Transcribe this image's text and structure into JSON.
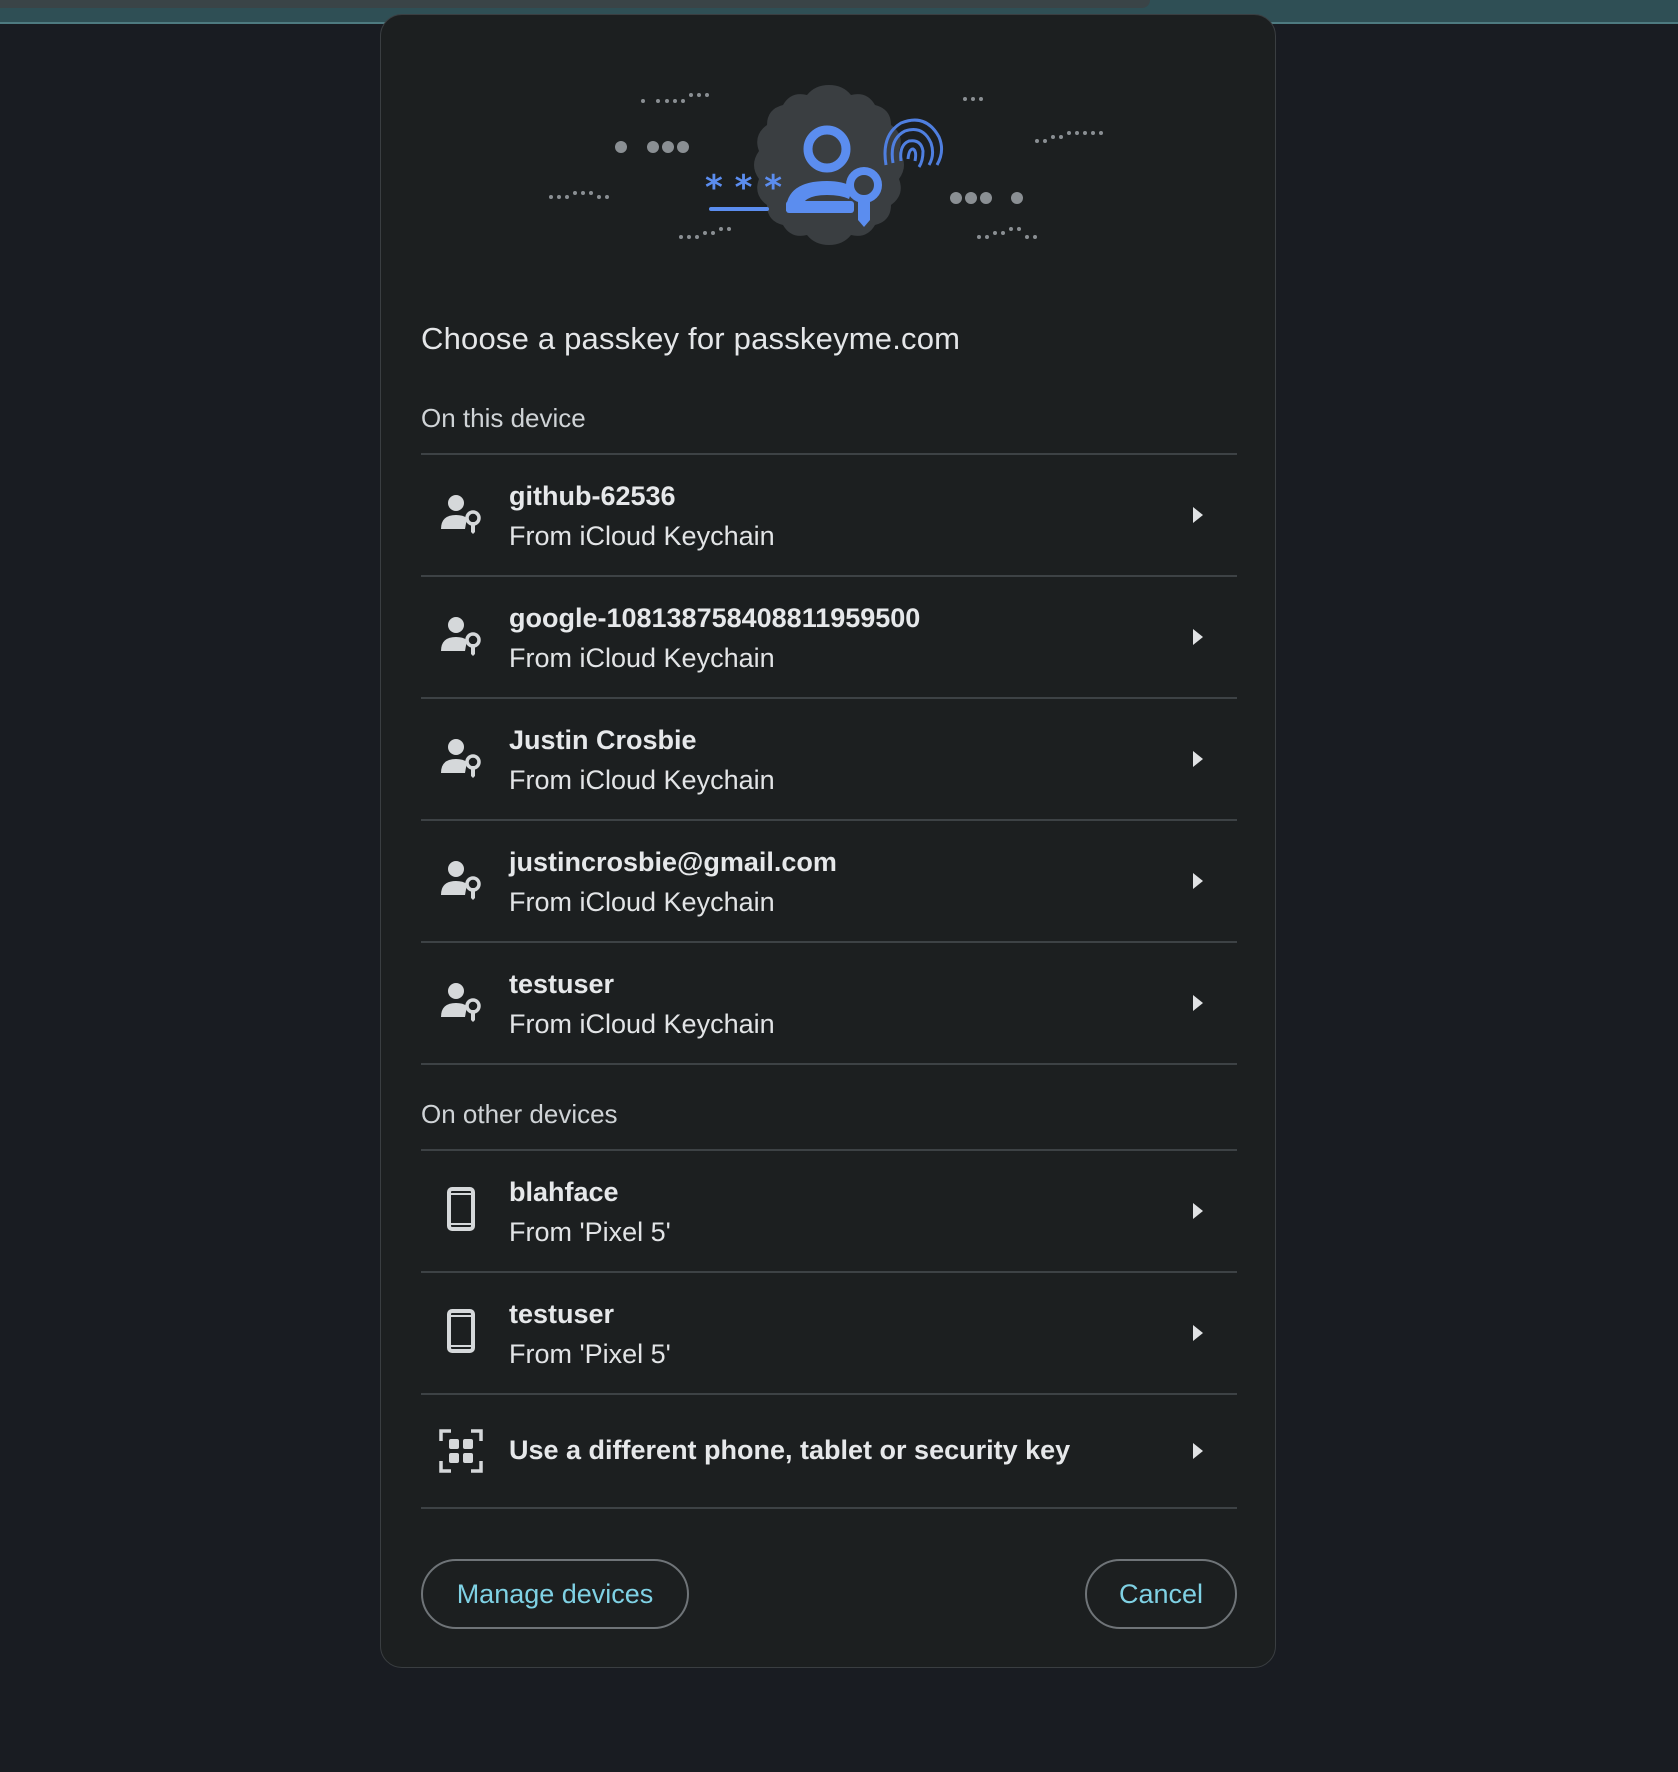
{
  "dialog": {
    "title": "Choose a passkey for passkeyme.com",
    "accent_color": "#5b8def"
  },
  "sections": [
    {
      "label": "On this device",
      "items": [
        {
          "title": "github-62536",
          "subtitle": "From iCloud Keychain",
          "icon": "person-key-icon"
        },
        {
          "title": "google-108138758408811959500",
          "subtitle": "From iCloud Keychain",
          "icon": "person-key-icon"
        },
        {
          "title": "Justin Crosbie",
          "subtitle": "From iCloud Keychain",
          "icon": "person-key-icon"
        },
        {
          "title": "justincrosbie@gmail.com",
          "subtitle": "From iCloud Keychain",
          "icon": "person-key-icon"
        },
        {
          "title": "testuser",
          "subtitle": "From iCloud Keychain",
          "icon": "person-key-icon"
        }
      ]
    },
    {
      "label": "On other devices",
      "items": [
        {
          "title": "blahface",
          "subtitle": "From 'Pixel 5'",
          "icon": "phone-icon"
        },
        {
          "title": "testuser",
          "subtitle": "From 'Pixel 5'",
          "icon": "phone-icon"
        },
        {
          "title": "Use a different phone, tablet or security key",
          "icon": "qr-code-icon"
        }
      ]
    }
  ],
  "buttons": {
    "manage": "Manage devices",
    "cancel": "Cancel"
  }
}
